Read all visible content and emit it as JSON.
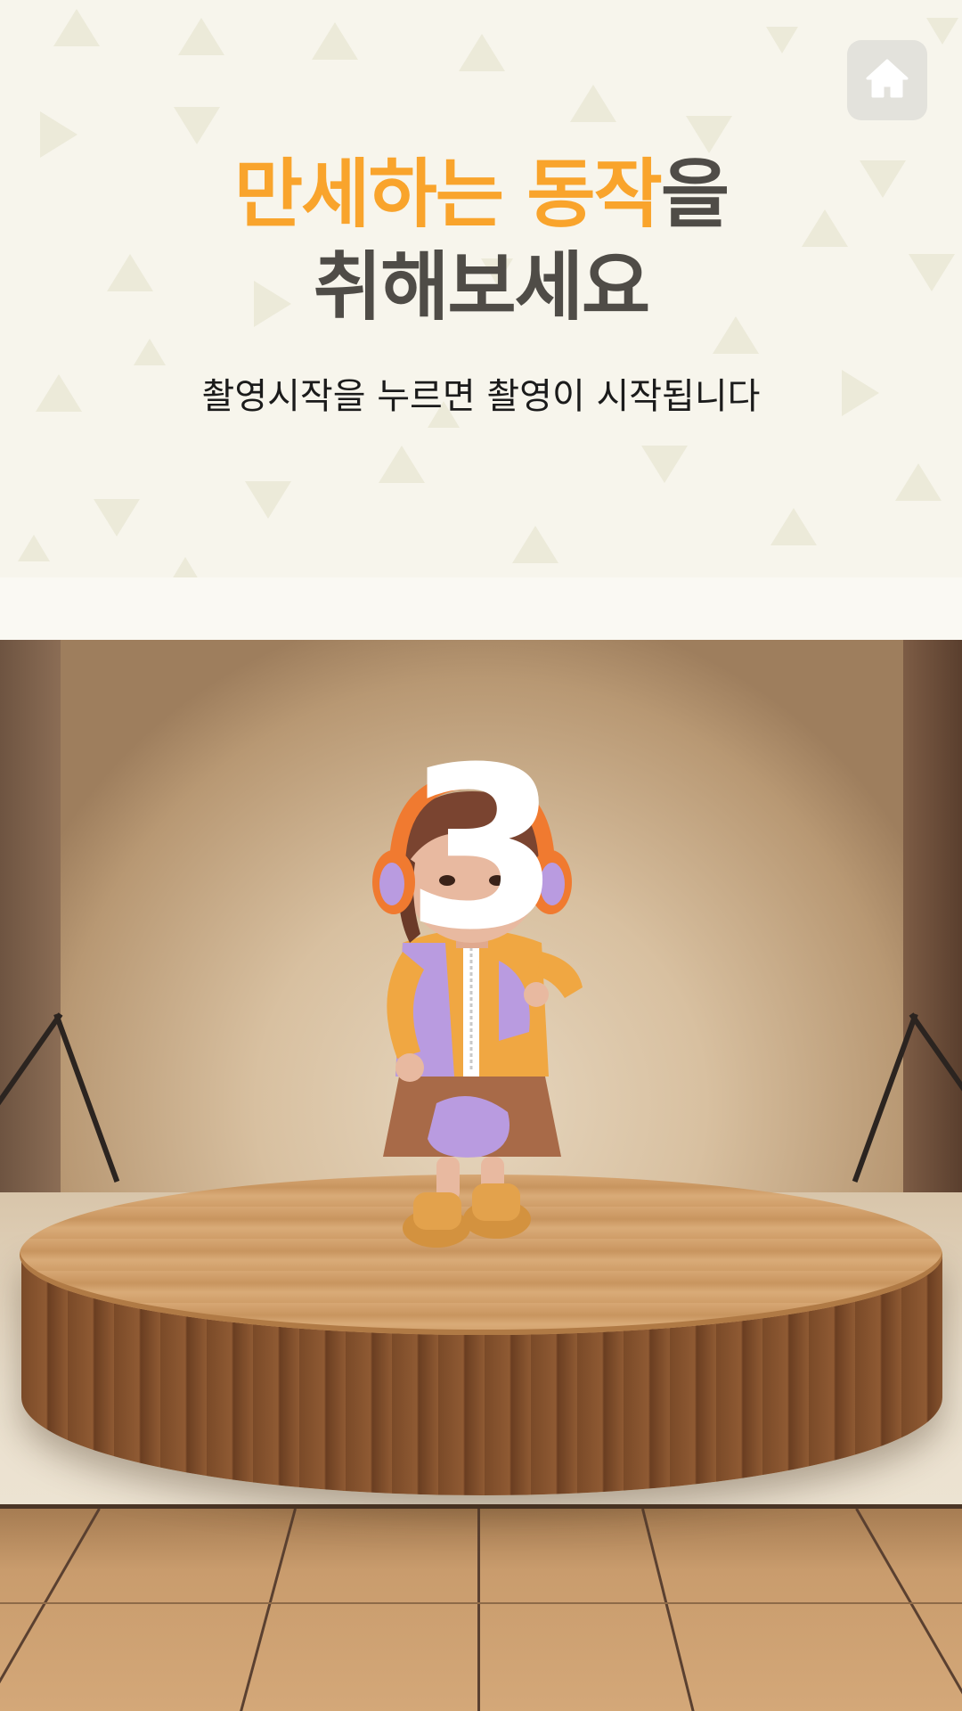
{
  "header": {
    "title_line1_highlight": "만세하는 동작",
    "title_line1_rest": "을",
    "title_line2": "취해보세요",
    "subtitle": "촬영시작을 누르면 촬영이 시작됩니다"
  },
  "controls": {
    "home_icon": "home-icon"
  },
  "countdown": {
    "value": "3"
  },
  "colors": {
    "accent": "#f9a42c",
    "title_dark": "#4f4c47",
    "panel_bg": "#f7f5ec",
    "home_button_bg": "#e3e2dc"
  }
}
